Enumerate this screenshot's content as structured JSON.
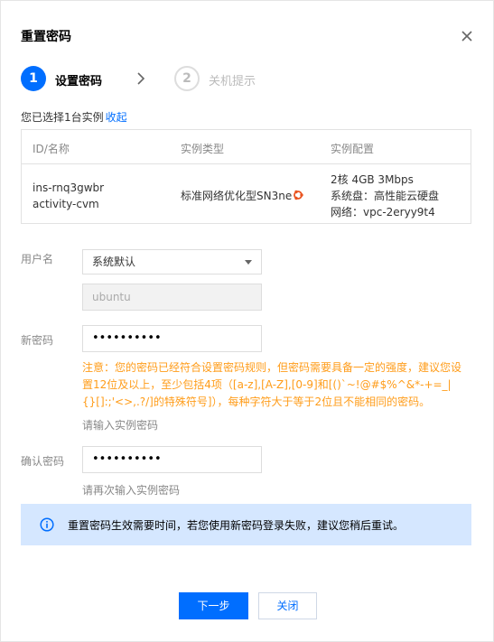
{
  "dialog": {
    "title": "重置密码",
    "close_icon": "close-icon"
  },
  "steps": [
    {
      "number": "1",
      "label": "设置密码",
      "active": true
    },
    {
      "number": "2",
      "label": "关机提示",
      "active": false
    }
  ],
  "selection": {
    "text": "您已选择1台实例",
    "collapse_link": "收起"
  },
  "instance_table": {
    "headers": [
      "ID/名称",
      "实例类型",
      "实例配置"
    ],
    "row": {
      "id": "ins-rnq3gwbr",
      "name": "activity-cvm",
      "type": "标准网络优化型SN3ne",
      "os_icon": "ubuntu-icon",
      "config": [
        "2核 4GB 3Mbps",
        "系统盘：高性能云硬盘",
        "网络：vpc-2eryy9t4"
      ]
    }
  },
  "form": {
    "username_label": "用户名",
    "username_select": "系统默认",
    "username_value": "ubuntu",
    "new_password_label": "新密码",
    "new_password_value": "••••••••••",
    "warning_text": "注意：您的密码已经符合设置密码规则，但密码需要具备一定的强度，建议您设置12位及以上，至少包括4项（[a-z],[A-Z],[0-9]和[()`~!@#$%^&*-+=_|{}[]:;'<>,.?/]的特殊符号]），每种字符大于等于2位且不能相同的密码。",
    "new_password_hint": "请输入实例密码",
    "confirm_password_label": "确认密码",
    "confirm_password_value": "••••••••••",
    "confirm_password_hint": "请再次输入实例密码"
  },
  "info": {
    "icon": "info-icon",
    "text": "重置密码生效需要时间，若您使用新密码登录失败，建议您稍后重试。"
  },
  "buttons": {
    "next": "下一步",
    "close": "关闭"
  },
  "colors": {
    "primary": "#006eff",
    "warning": "#ff9c19",
    "info_bg": "#d5e7ff",
    "ubuntu": "#e95420"
  }
}
